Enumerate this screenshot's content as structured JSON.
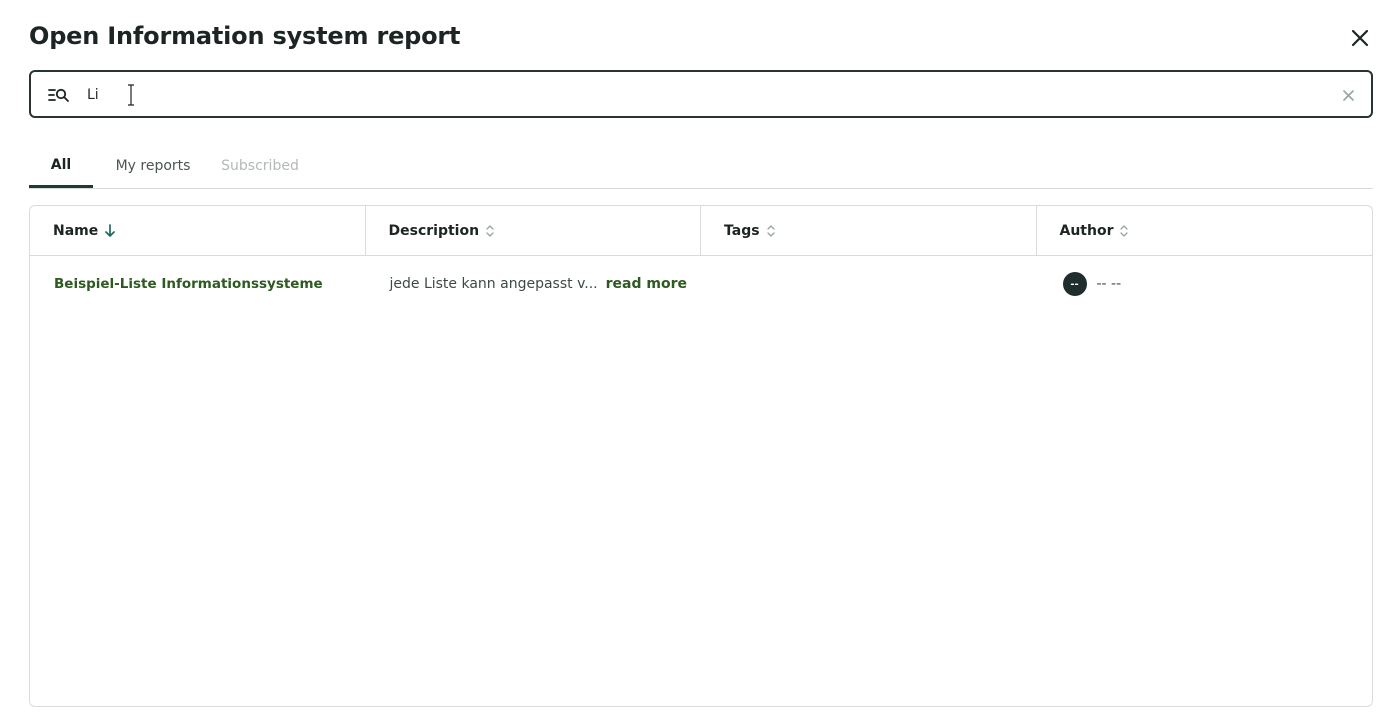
{
  "dialog": {
    "title": "Open Information system report"
  },
  "search": {
    "value": "Li",
    "placeholder": ""
  },
  "tabs": [
    {
      "label": "All",
      "active": true
    },
    {
      "label": "My reports",
      "active": false
    },
    {
      "label": "Subscribed",
      "active": false,
      "disabled": true
    }
  ],
  "table": {
    "columns": [
      {
        "label": "Name",
        "sort": "descending",
        "sort_icon": "arrow-down-icon"
      },
      {
        "label": "Description",
        "sort": "none",
        "sort_icon": "sort-icon"
      },
      {
        "label": "Tags",
        "sort": "none",
        "sort_icon": "sort-icon"
      },
      {
        "label": "Author",
        "sort": "none",
        "sort_icon": "sort-icon"
      }
    ],
    "rows": [
      {
        "name": "Beispiel-Liste Informationssysteme",
        "description": "jede Liste kann angepasst v...",
        "read_more": "read more",
        "tags": "",
        "author_initials": "--",
        "author_name": "-- --"
      }
    ]
  },
  "colors": {
    "accent_green": "#2c5a1f",
    "dark": "#1c2424",
    "border": "#d9dcdc",
    "sort_active": "#1f6b5e"
  }
}
